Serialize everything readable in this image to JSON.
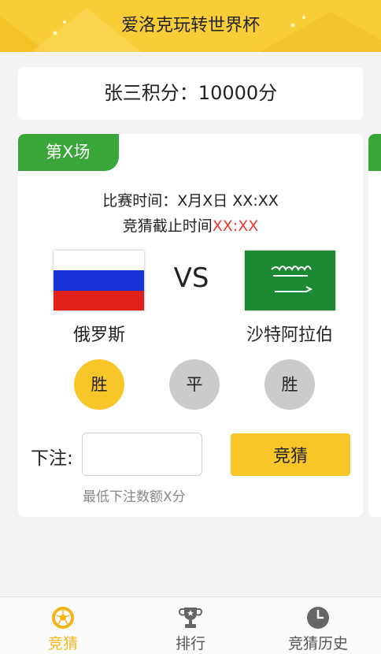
{
  "header": {
    "title": "爱洛克玩转世界杯",
    "bg_color": "#f9cd38"
  },
  "score_card": {
    "text": "张三积分：10000分"
  },
  "match": {
    "round_label": "第X场",
    "match_time": "比赛时间：X月X日  XX:XX",
    "deadline_prefix": "竞猜截止时间",
    "deadline_time": "XX:XX",
    "vs_label": "VS",
    "home_team": {
      "name": "俄罗斯",
      "flag": "russia-flag"
    },
    "away_team": {
      "name": "沙特阿拉伯",
      "flag": "saudi-arabia-flag"
    },
    "options": [
      {
        "label": "胜",
        "selected": true
      },
      {
        "label": "平",
        "selected": false
      },
      {
        "label": "胜",
        "selected": false
      }
    ],
    "bet_label": "下注:",
    "bet_value": "",
    "bet_placeholder": "",
    "guess_button": "竞猜",
    "min_bet_hint": "最低下注数额X分"
  },
  "tabbar": {
    "items": [
      {
        "label": "竞猜",
        "icon": "soccer-ball-icon",
        "active": true
      },
      {
        "label": "排行",
        "icon": "trophy-icon",
        "active": false
      },
      {
        "label": "竞猜历史",
        "icon": "clock-icon",
        "active": false
      }
    ]
  },
  "colors": {
    "accent_yellow": "#f9c62a",
    "round_green": "#3aa63a",
    "deadline_red": "#e83a2f",
    "inactive_gray": "#cbcbcb"
  }
}
